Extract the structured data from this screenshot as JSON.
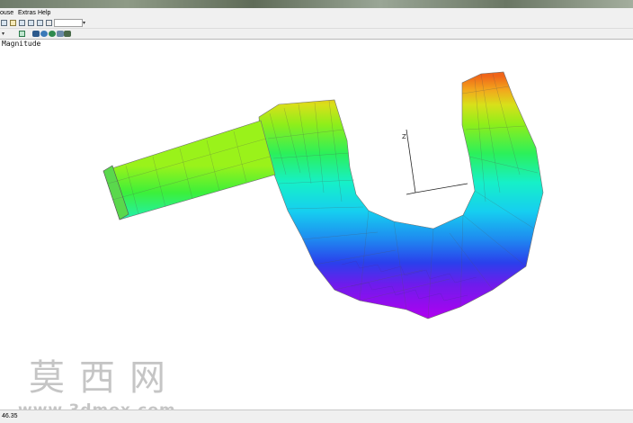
{
  "menubar": {
    "items": [
      "ouse",
      "Extras",
      "Help"
    ]
  },
  "viewport": {
    "label": "Magnitude"
  },
  "axes": {
    "z_label": "Z"
  },
  "statusbar": {
    "text": "46.35"
  },
  "watermark": {
    "chinese": "莫西网",
    "url": "www.3dmox.com"
  },
  "colors": {
    "chrome": "#f0f0f0",
    "accent_icon": "#d7e3ee",
    "model_top": "#e86a1a",
    "model_bottom": "#a300e8"
  },
  "icons": [
    "new-icon",
    "open-icon",
    "copy-icon",
    "paste-icon",
    "cursor-icon",
    "ribbon-icon",
    "rotate-icon",
    "zoom-icon",
    "view-icon"
  ]
}
